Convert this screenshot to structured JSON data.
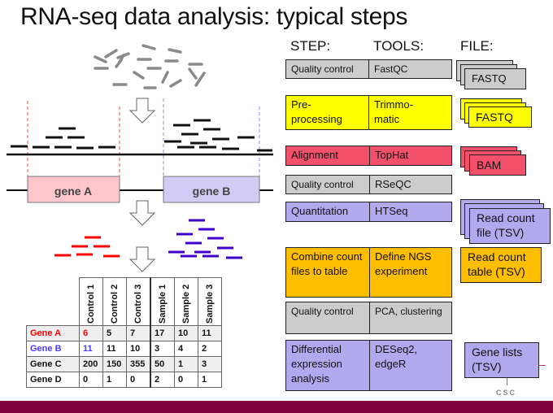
{
  "title": "RNA-seq data analysis: typical steps",
  "column_headers": {
    "step": "STEP:",
    "tools": "TOOLS:",
    "file": "FILE:"
  },
  "genes": {
    "gene_a": "gene A",
    "gene_b": "gene B"
  },
  "colors": {
    "gray": "#cccccc",
    "yellow": "#ffff00",
    "red": "#f2506b",
    "purple": "#b2a8ee",
    "orange": "#ffbf00",
    "gene_a_fill": "#ffc7cc",
    "gene_b_fill": "#d2ccf4",
    "read_red": "#ff0000",
    "read_blue": "#4000cc",
    "footer": "#7f003c"
  },
  "pipeline": [
    {
      "step": "Quality control",
      "tool": "FastQC",
      "color": "gray",
      "file": "FASTQ"
    },
    {
      "step": "Pre-\nprocessing",
      "tool": "Trimmo-\nmatic",
      "color": "yellow",
      "file": "FASTQ"
    },
    {
      "step": "Alignment",
      "tool": "TopHat",
      "color": "red",
      "file": "BAM"
    },
    {
      "step": "Quality control",
      "tool": "RSeQC",
      "color": "gray",
      "file": ""
    },
    {
      "step": "Quantitation",
      "tool": "HTSeq",
      "color": "purple",
      "file": "Read count file (TSV)"
    },
    {
      "step": "Combine count files to table",
      "tool": "Define NGS experiment",
      "color": "orange",
      "file": "Read count table (TSV)"
    },
    {
      "step": "Quality control",
      "tool": "PCA, clustering",
      "color": "gray",
      "file": ""
    },
    {
      "step": "Differential expression analysis",
      "tool": "DESeq2, edgeR",
      "color": "purple",
      "file": "Gene lists (TSV)"
    }
  ],
  "count_table": {
    "columns": [
      "Control 1",
      "Control 2",
      "Control 3",
      "Sample 1",
      "Sample 2",
      "Sample 3"
    ],
    "rows": [
      {
        "gene": "Gene A",
        "values": [
          "6",
          "5",
          "7",
          "17",
          "10",
          "11"
        ]
      },
      {
        "gene": "Gene B",
        "values": [
          "11",
          "11",
          "10",
          "3",
          "4",
          "2"
        ]
      },
      {
        "gene": "Gene C",
        "values": [
          "200",
          "150",
          "355",
          "50",
          "1",
          "3"
        ]
      },
      {
        "gene": "Gene D",
        "values": [
          "0",
          "1",
          "0",
          "2",
          "0",
          "1"
        ]
      }
    ]
  },
  "logo": "CSC"
}
